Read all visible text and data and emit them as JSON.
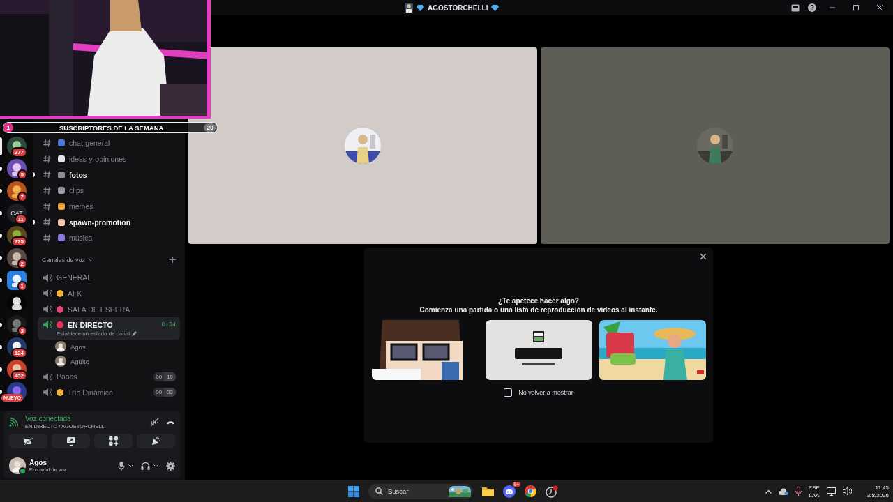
{
  "stream_overlay": {
    "kind": "picture",
    "rank": "1",
    "title": "SUSCRIPTORES DE LA SEMANA",
    "count": "20"
  },
  "title_bar": {
    "title": "AGOSTORCHELLI"
  },
  "servers": [
    {
      "selected": true,
      "badge": "277"
    },
    {
      "selected": false,
      "unread": true,
      "badge": "5"
    },
    {
      "selected": false,
      "unread": true,
      "badge": "7"
    },
    {
      "selected": false,
      "unread": true,
      "label": "CAT",
      "badge": "11"
    },
    {
      "selected": false,
      "unread": true,
      "badge": "275"
    },
    {
      "selected": false,
      "unread": true,
      "badge": "2"
    },
    {
      "selected": false,
      "unread": true,
      "badge": "1"
    },
    {
      "selected": false,
      "unread": false
    },
    {
      "selected": false,
      "unread": true,
      "badge": "3"
    },
    {
      "selected": false,
      "unread": true,
      "badge": "124"
    },
    {
      "selected": false,
      "unread": true,
      "badge": "452"
    },
    {
      "selected": false,
      "unread": true,
      "new_label": "NUEVO"
    }
  ],
  "text_channels": [
    {
      "name": "chat-general",
      "unread": false
    },
    {
      "name": "ideas-y-opiniones",
      "unread": false
    },
    {
      "name": "fotos",
      "unread": true
    },
    {
      "name": "clips",
      "unread": false
    },
    {
      "name": "memes",
      "unread": false
    },
    {
      "name": "spawn-promotion",
      "unread": true
    },
    {
      "name": "musica",
      "unread": false
    }
  ],
  "voice_header": "Canales de voz",
  "voice_channels": [
    {
      "name": "GENERAL",
      "selected": false,
      "connected": false
    },
    {
      "name": "AFK",
      "selected": false,
      "connected": false
    },
    {
      "name": "SALA DE ESPERA",
      "selected": false,
      "connected": false
    },
    {
      "name": "EN DIRECTO",
      "selected": true,
      "connected": true,
      "timer": "0:34",
      "status": "Establece un estado de canal",
      "members": [
        {
          "name": "Agos"
        },
        {
          "name": "Aguito"
        }
      ]
    },
    {
      "name": "Panas",
      "selected": false,
      "connected": false,
      "user_count": "00",
      "user_limit": "10"
    },
    {
      "name": "Trío Dinámico",
      "selected": false,
      "connected": false,
      "user_count": "00",
      "user_limit": "02"
    }
  ],
  "voice_status": {
    "title": "Voz conectada",
    "location": "EN DIRECTO / AGOSTORCHELLI"
  },
  "user": {
    "name": "Agos",
    "status": "En canal de voz"
  },
  "activity": {
    "title": "¿Te apetece hacer algo?",
    "subtitle": "Comienza una partida o una lista de reproducción de vídeos al instante.",
    "dont_show": {
      "label": "No volver a mostrar",
      "checked": false
    }
  },
  "taskbar": {
    "search": {
      "placeholder": "Buscar"
    },
    "discord_badge": "9+",
    "language": "ESP",
    "layout": "LAA",
    "time": "11:45",
    "date": "3/8/2026"
  }
}
